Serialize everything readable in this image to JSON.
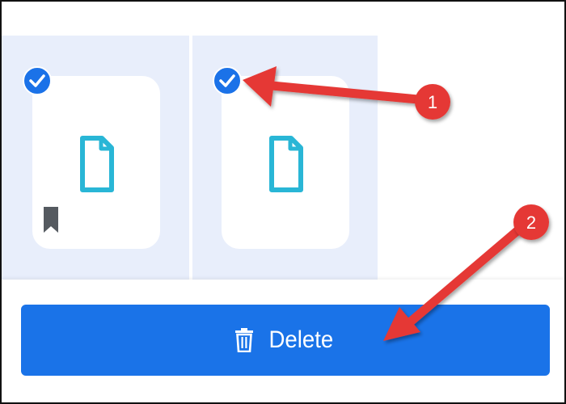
{
  "items": [
    {
      "selected": true,
      "bookmarked": true,
      "icon": "file-icon"
    },
    {
      "selected": true,
      "bookmarked": false,
      "icon": "file-icon"
    }
  ],
  "action_bar": {
    "delete_label": "Delete",
    "delete_icon": "trash-icon"
  },
  "annotations": [
    {
      "label": "1"
    },
    {
      "label": "2"
    }
  ],
  "colors": {
    "accent": "#1a73e8",
    "tile_selected_bg": "#e8eefb",
    "file_icon": "#29b6d6",
    "arrow": "#e53935"
  }
}
